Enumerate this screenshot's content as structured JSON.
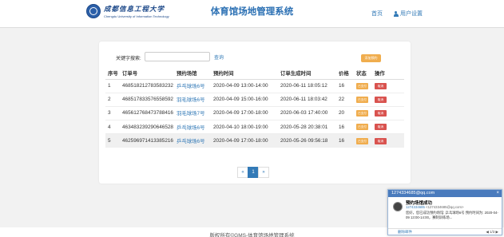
{
  "header": {
    "logo_cn": "成都信息工程大学",
    "logo_en": "Chengdu University of Information Technology",
    "title": "体育馆场地管理系统",
    "nav_home": "首页",
    "nav_user": "用户设置"
  },
  "search": {
    "label": "关键字搜索:",
    "value": "",
    "button": "查询"
  },
  "export_label": "添加预约",
  "table": {
    "columns": [
      "序号",
      "订单号",
      "预约场馆",
      "预约时间",
      "订单生成时间",
      "价格",
      "状态",
      "操作"
    ],
    "status_label": "已支付",
    "cancel_label": "取消",
    "rows": [
      {
        "no": "1",
        "order": "468518212783583232",
        "venue": "乒乓球场6号",
        "time": "2020-04-09 13:00-14:00",
        "created": "2020-06-11 18:05:12",
        "price": "16"
      },
      {
        "no": "2",
        "order": "468517833576558592",
        "venue": "羽毛球场6号",
        "time": "2020-04-09 15:00-16:00",
        "created": "2020-06-11 18:03:42",
        "price": "22"
      },
      {
        "no": "3",
        "order": "465612768473788416",
        "venue": "羽毛球场7号",
        "time": "2020-04-09 17:00-18:00",
        "created": "2020-06-03 17:40:00",
        "price": "20"
      },
      {
        "no": "4",
        "order": "463483239290646528",
        "venue": "乒乓球场6号",
        "time": "2020-04-10 18:00-19:00",
        "created": "2020-05-28 20:38:01",
        "price": "16"
      },
      {
        "no": "5",
        "order": "462596971413385216",
        "venue": "乒乓球场6号",
        "time": "2020-04-09 17:00-18:00",
        "created": "2020-05-26 09:56:18",
        "price": "16"
      }
    ]
  },
  "pager": {
    "prev": "«",
    "current": "1",
    "next": "»"
  },
  "footer": "版权所有©GMS-体育馆场地管理系统",
  "popup": {
    "header": "1274334685@qq.com",
    "close": "×",
    "title": "预约场馆成功",
    "from_name": "1274334685",
    "from_addr": "<1274334685@qq.com>",
    "body": "您好，您已成功预约场馆: 乒乓球场6号 预约时间为: 2020-04-09 13:00-14:00，赛制训练场...",
    "delete": "删除邮件",
    "nav": "◀  1/3  ▶"
  }
}
